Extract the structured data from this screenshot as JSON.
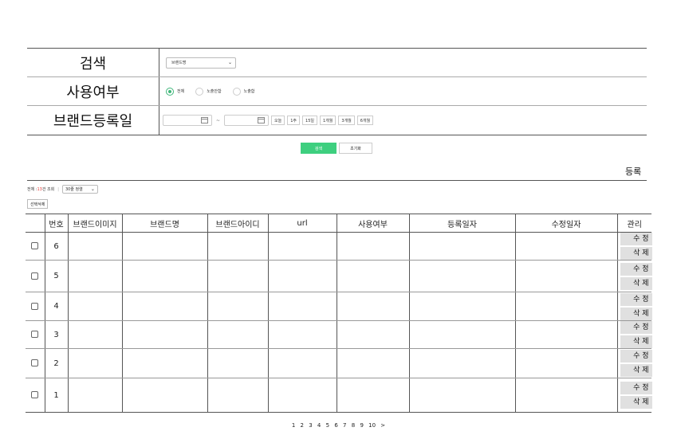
{
  "search": {
    "rows": {
      "keyword_label": "검색",
      "usage_label": "사용여부",
      "regdate_label": "브랜드등록일"
    },
    "keyword_select": "브랜드명",
    "radios": [
      "전체",
      "노출안함",
      "노출함"
    ],
    "selected_radio": "전체",
    "tilde": "~",
    "periods": [
      "오늘",
      "1주",
      "15일",
      "1개월",
      "3개월",
      "6개월"
    ],
    "search_button": "검색",
    "reset_button": "초기화"
  },
  "register_label": "등록",
  "toolbar": {
    "total_prefix": "전체 : ",
    "count": "13",
    "total_suffix": "건 조회",
    "sort_select": "30줄 정렬",
    "delete_selected": "선택삭제"
  },
  "table": {
    "headers": [
      "",
      "번호",
      "브랜드이미지",
      "브랜드명",
      "브랜드아이디",
      "url",
      "사용여부",
      "등록일자",
      "수정일자",
      "관리"
    ],
    "rows": [
      {
        "no": "6"
      },
      {
        "no": "5"
      },
      {
        "no": "4"
      },
      {
        "no": "3"
      },
      {
        "no": "2"
      },
      {
        "no": "1"
      }
    ],
    "edit_label": "수 정",
    "delete_label": "삭 제"
  },
  "pagination": [
    "1",
    "2",
    "3",
    "4",
    "5",
    "6",
    "7",
    "8",
    "9",
    "10",
    ">"
  ],
  "colors": {
    "accent": "#3ecf7f",
    "count": "#e53935"
  }
}
